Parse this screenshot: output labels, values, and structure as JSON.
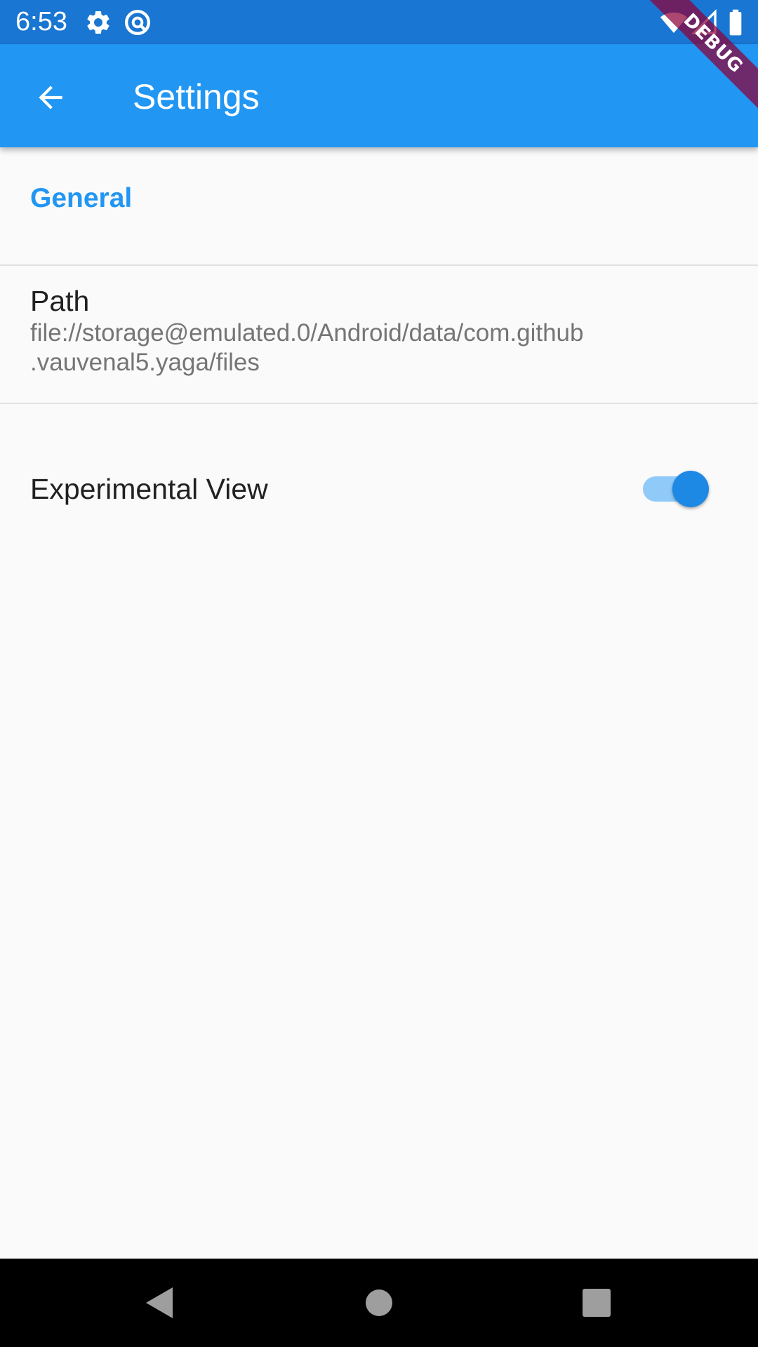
{
  "status_bar": {
    "time": "6:53",
    "icons": [
      "gear-icon",
      "at-sign-icon",
      "wifi-icon",
      "signal-icon",
      "battery-icon"
    ],
    "background": "#1976d2"
  },
  "app_bar": {
    "title": "Settings",
    "back_icon": "arrow-back-icon",
    "background": "#2196f3"
  },
  "debug_banner": {
    "label": "DEBUG"
  },
  "settings": {
    "section_header": "General",
    "path": {
      "title": "Path",
      "subtitle": "file://storage@emulated.0/Android/data/com.github\n.vauvenal5.yaga/files"
    },
    "experimental_view": {
      "title": "Experimental View",
      "enabled": true
    }
  },
  "nav_bar": {
    "buttons": [
      "back-triangle-icon",
      "home-circle-icon",
      "recents-square-icon"
    ]
  },
  "colors": {
    "accent": "#2196f3",
    "switch_thumb": "#1e88e5",
    "switch_track": "#90caf9",
    "text_primary": "#212121",
    "text_secondary": "#757575"
  }
}
